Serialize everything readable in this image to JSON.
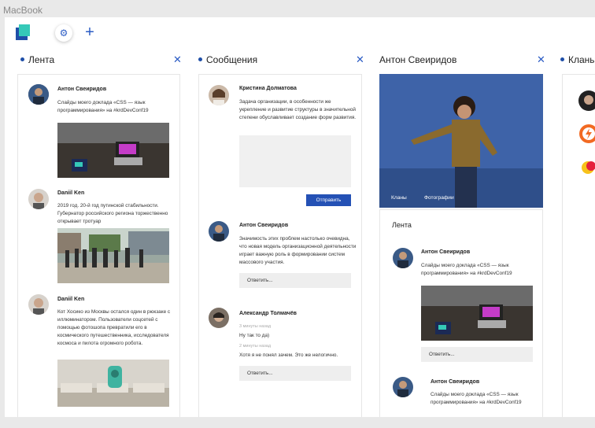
{
  "frame_label": "MacBook",
  "colors": {
    "accent": "#2451b5",
    "brand_teal": "#35c9b8",
    "brand_blue": "#1f4fa8"
  },
  "topbar": {
    "logo": "app-logo",
    "settings_icon": "gear-icon",
    "add_icon": "plus-icon",
    "settings_glyph": "⚙",
    "add_glyph": "+"
  },
  "feed": {
    "title": "Лента",
    "close_glyph": "✕",
    "posts": [
      {
        "author": "Антон Свеиридов",
        "text": "Слайды моего доклада «CSS — язык программирования» на #krdDevConf19"
      },
      {
        "author": "Daniil Ken",
        "text": "2019 год. 20-й год путинской стабильности. Губернатор российского региона торжественно открывает тротуар"
      },
      {
        "author": "Daniil Ken",
        "text": "Кот Хосико из Москвы остался один в рюкзаке с иллюминатором. Пользователи соцсетей с помощью фотошопа превратили его в космического путешественника, исследователя космоса и пилота огромного робота."
      }
    ]
  },
  "messages": {
    "title": "Сообщения",
    "close_glyph": "✕",
    "threads": [
      {
        "author": "Кристина Долматова",
        "text": "Задача организации, в особенности же укрепление и развитие структуры в значительной степени обуславливает создание форм развития.",
        "send_label": "Отправить"
      },
      {
        "author": "Антон Свеиридов",
        "text": "Значимость этих проблем настолько очевидна, что новая модель организационной деятельности играет важную роль в формировании систем массового участия.",
        "reply_label": "Ответить..."
      },
      {
        "author": "Александр Толмачёв",
        "lines": [
          {
            "meta": "3 минуты назад",
            "text": "Ну так то да)"
          },
          {
            "meta": "2 минуты назад",
            "text": "Хотя я не понял зачем. Это же нелогично."
          }
        ],
        "reply_label": "Ответить..."
      }
    ]
  },
  "profile": {
    "title": "Антон Свеиридов",
    "close_glyph": "✕",
    "tabs": [
      "Кланы",
      "Фотографии"
    ],
    "feed_title": "Лента",
    "posts": [
      {
        "author": "Антон Свеиридов",
        "text": "Слайды моего доклада «CSS — язык программирования» на #krdDevConf19",
        "reply_label": "Ответить..."
      },
      {
        "author": "Антон Свеиридов",
        "text": "Слайды моего доклада «CSS — язык программирования» на #krdDevConf19"
      }
    ]
  },
  "clans": {
    "title": "Кланы"
  }
}
